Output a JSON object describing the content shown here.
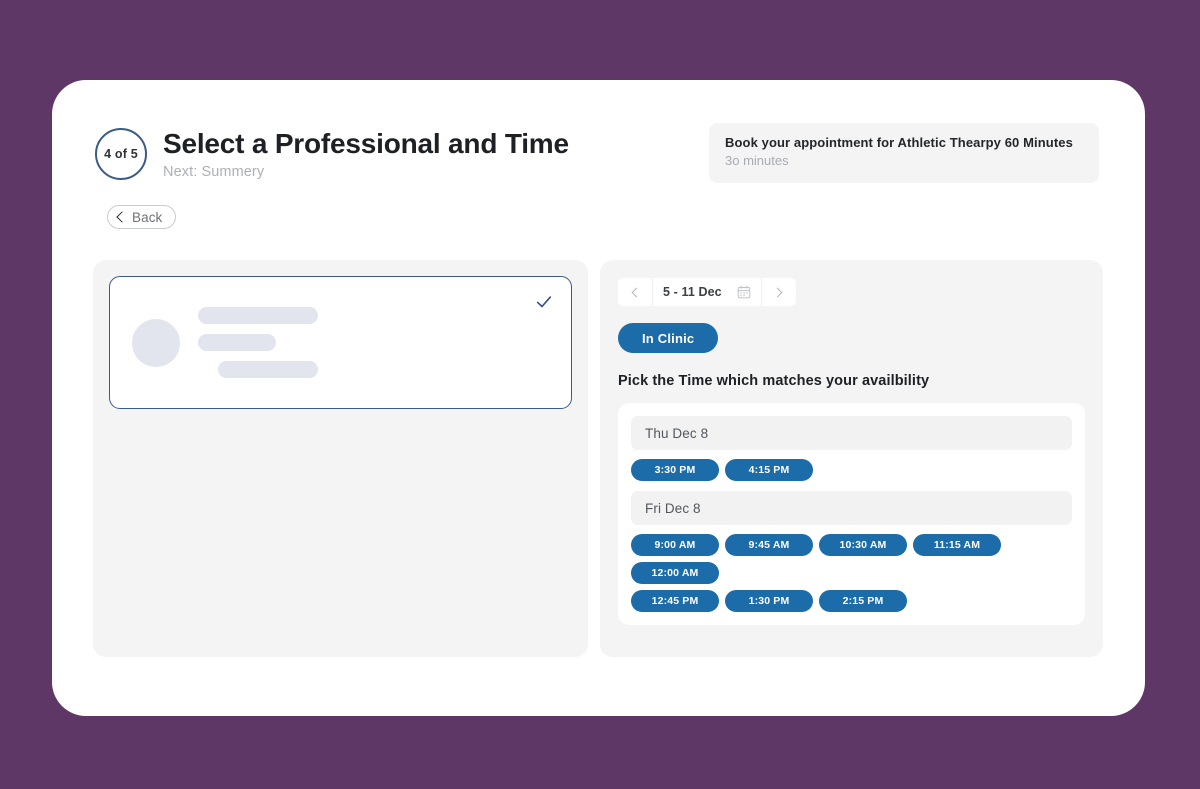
{
  "header": {
    "step_badge": "4 of 5",
    "title": "Select a Professional and Time",
    "subtitle": "Next: Summery",
    "back_label": "Back"
  },
  "appointment_info": {
    "title": "Book your appointment for Athletic Thearpy 60 Minutes",
    "duration": "3o minutes"
  },
  "professional_panel": {
    "selected_card": {
      "selected": "true",
      "check_icon": "check-icon",
      "avatar": "avatar-placeholder"
    }
  },
  "schedule_panel": {
    "date_nav": {
      "prev_icon": "chevron-left-icon",
      "next_icon": "chevron-right-icon",
      "range_label": "5 - 11 Dec",
      "calendar_icon": "calendar-icon"
    },
    "mode_tab": "In Clinic",
    "section_heading": "Pick the Time which matches your availbility",
    "days": [
      {
        "label": "Thu Dec 8",
        "rows": [
          [
            "3:30 PM",
            "4:15 PM"
          ]
        ]
      },
      {
        "label": "Fri Dec 8",
        "rows": [
          [
            "9:00 AM",
            "9:45 AM",
            "10:30 AM",
            "11:15 AM",
            "12:00 AM"
          ],
          [
            "12:45 PM",
            "1:30 PM",
            "2:15 PM"
          ]
        ]
      }
    ]
  },
  "colors": {
    "page_background": "#5e3767",
    "accent_blue": "#1b6ca8",
    "selected_border": "#3a5a87",
    "panel_gray": "#f4f4f5"
  }
}
